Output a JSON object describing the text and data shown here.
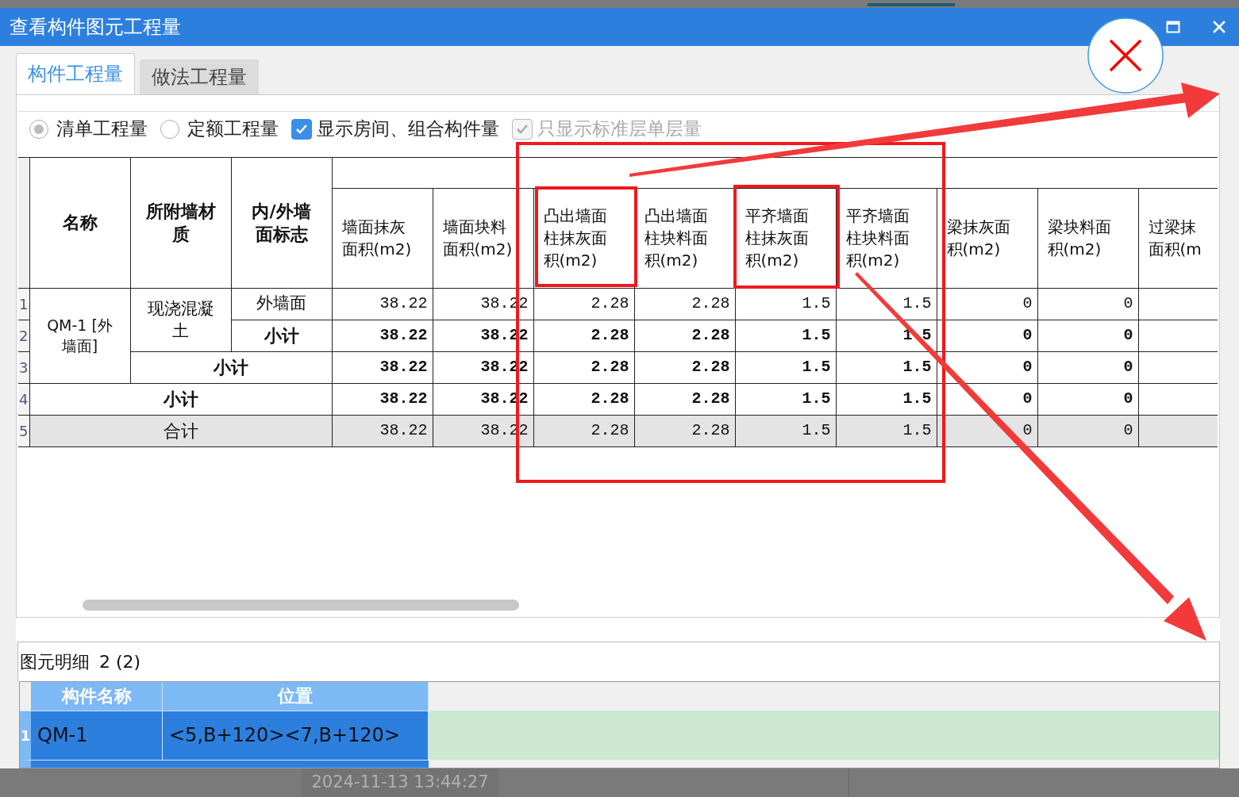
{
  "window": {
    "title": "查看构件图元工程量"
  },
  "tabs": [
    {
      "label": "构件工程量",
      "selected": true
    },
    {
      "label": "做法工程量",
      "selected": false
    }
  ],
  "options": [
    {
      "kind": "radio",
      "label": "清单工程量",
      "selected": true,
      "disabled": false
    },
    {
      "kind": "radio",
      "label": "定额工程量",
      "selected": false,
      "disabled": false
    },
    {
      "kind": "checkbox",
      "label": "显示房间、组合构件量",
      "checked": true,
      "disabled": false
    },
    {
      "kind": "checkbox",
      "label": "只显示标准层单层量",
      "checked": true,
      "disabled": true
    }
  ],
  "table": {
    "label_columns": [
      {
        "lines": [
          "名称"
        ]
      },
      {
        "lines": [
          "所附墙材",
          "质"
        ]
      },
      {
        "lines": [
          "内/外墙",
          "面标志"
        ]
      }
    ],
    "columns": [
      {
        "lines": [
          "墙面抹灰",
          "面积(m2)"
        ]
      },
      {
        "lines": [
          "墙面块料",
          "面积(m2)"
        ]
      },
      {
        "lines": [
          "凸出墙面",
          "柱抹灰面",
          "积(m2)"
        ]
      },
      {
        "lines": [
          "凸出墙面",
          "柱块料面",
          "积(m2)"
        ]
      },
      {
        "lines": [
          "平齐墙面",
          "柱抹灰面",
          "积(m2)"
        ]
      },
      {
        "lines": [
          "平齐墙面",
          "柱块料面",
          "积(m2)"
        ]
      },
      {
        "lines": [
          "梁抹灰面",
          "积(m2)"
        ]
      },
      {
        "lines": [
          "梁块料面",
          "积(m2)"
        ]
      },
      {
        "lines": [
          "过梁抹",
          "面积(m"
        ]
      }
    ],
    "rows": [
      {
        "number": "1",
        "kind": "detail",
        "name": "QM-1 [外墙面]",
        "material": "现浇混凝土",
        "side": "外墙面",
        "values": [
          "38.22",
          "38.22",
          "2.28",
          "2.28",
          "1.5",
          "1.5",
          "0",
          "0"
        ]
      },
      {
        "number": "2",
        "kind": "side_subtotal",
        "label": "小计",
        "values": [
          "38.22",
          "38.22",
          "2.28",
          "2.28",
          "1.5",
          "1.5",
          "0",
          "0"
        ]
      },
      {
        "number": "3",
        "kind": "material_subtotal",
        "label": "小计",
        "values": [
          "38.22",
          "38.22",
          "2.28",
          "2.28",
          "1.5",
          "1.5",
          "0",
          "0"
        ]
      },
      {
        "number": "4",
        "kind": "name_subtotal",
        "label": "小计",
        "values": [
          "38.22",
          "38.22",
          "2.28",
          "2.28",
          "1.5",
          "1.5",
          "0",
          "0"
        ]
      },
      {
        "number": "5",
        "kind": "total",
        "label": "合计",
        "values": [
          "38.22",
          "38.22",
          "2.28",
          "2.28",
          "1.5",
          "1.5",
          "0",
          "0"
        ]
      }
    ]
  },
  "details": {
    "label": "图元明细",
    "count": "2 (2)",
    "columns": [
      "构件名称",
      "位置"
    ],
    "rows": [
      {
        "number": "1",
        "selected": true,
        "cells": [
          "QM-1",
          "<5,B+120><7,B+120>"
        ]
      }
    ]
  },
  "taskbar": {
    "timestamp": "2024-11-13 13:44:27"
  }
}
